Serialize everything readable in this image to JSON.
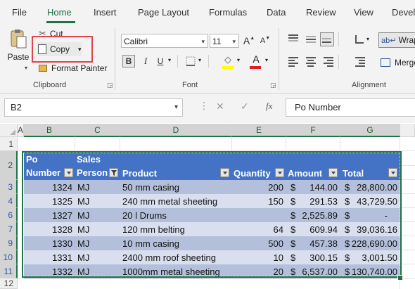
{
  "ribbon_tabs": [
    "File",
    "Home",
    "Insert",
    "Page Layout",
    "Formulas",
    "Data",
    "Review",
    "View",
    "Devel"
  ],
  "clipboard": {
    "paste_label": "Paste",
    "cut_label": "Cut",
    "copy_label": "Copy",
    "format_painter_label": "Format Painter",
    "group_label": "Clipboard"
  },
  "font": {
    "name": "Calibri",
    "size": "11",
    "group_label": "Font",
    "bold": "B",
    "italic": "I",
    "underline": "U",
    "grow": "A",
    "shrink": "A",
    "font_color_glyph": "A",
    "font_color": "#e02020",
    "fill_color": "#ffff00"
  },
  "alignment": {
    "wrap_label": "Wrap",
    "merge_label": "Merge",
    "group_label": "Alignment"
  },
  "formula_bar": {
    "name_box": "B2",
    "cancel": "✕",
    "enter": "✓",
    "fx": "fx",
    "content": "Po Number"
  },
  "grid": {
    "columns": [
      "A",
      "B",
      "C",
      "D",
      "E",
      "F",
      "G"
    ],
    "rows": [
      "1",
      "2",
      "3",
      "4",
      "5",
      "6",
      "7",
      "8",
      "9",
      "10",
      "11",
      "12"
    ]
  },
  "table": {
    "header": {
      "po_line1": "Po",
      "po_line2": "Number",
      "sales_line1": "Sales",
      "sales_line2": "Person",
      "product": "Product",
      "quantity": "Quantity",
      "amount": "Amount",
      "total": "Total"
    },
    "rows": [
      {
        "po": "1324",
        "person": "MJ",
        "product": "50 mm casing",
        "qty": "200",
        "cur1": "$",
        "amount": "144.00",
        "cur2": "$",
        "total": "28,800.00"
      },
      {
        "po": "1325",
        "person": "MJ",
        "product": "240 mm metal sheeting",
        "qty": "150",
        "cur1": "$",
        "amount": "291.53",
        "cur2": "$",
        "total": "43,729.50"
      },
      {
        "po": "1327",
        "person": "MJ",
        "product": "20 l Drums",
        "qty": "",
        "cur1": "$",
        "amount": "2,525.89",
        "cur2": "$",
        "total": "-"
      },
      {
        "po": "1328",
        "person": "MJ",
        "product": "120 mm belting",
        "qty": "64",
        "cur1": "$",
        "amount": "609.94",
        "cur2": "$",
        "total": "39,036.16"
      },
      {
        "po": "1330",
        "person": "MJ",
        "product": "10 mm casing",
        "qty": "500",
        "cur1": "$",
        "amount": "457.38",
        "cur2": "$",
        "total": "228,690.00"
      },
      {
        "po": "1331",
        "person": "MJ",
        "product": "2400 mm roof sheeting",
        "qty": "10",
        "cur1": "$",
        "amount": "300.15",
        "cur2": "$",
        "total": "3,001.50"
      },
      {
        "po": "1332",
        "person": "MJ",
        "product": "1000mm metal sheeting",
        "qty": "20",
        "cur1": "$",
        "amount": "6,537.00",
        "cur2": "$",
        "total": "130,740.00"
      }
    ]
  },
  "colors": {
    "accent": "#217346",
    "table_header": "#4472c4",
    "band_dark": "#b4c0db",
    "band_light": "#d9dfee",
    "callout": "#e0434c"
  }
}
